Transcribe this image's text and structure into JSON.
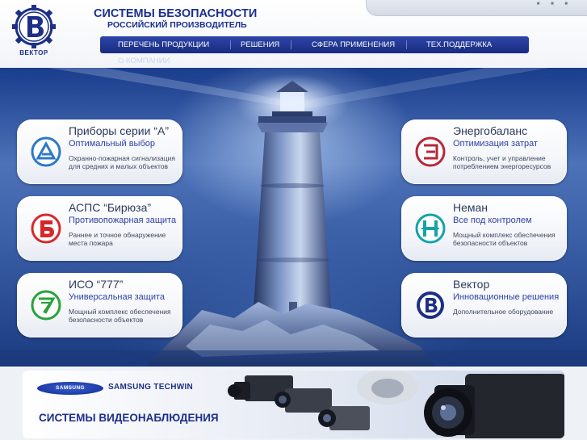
{
  "header": {
    "logo_text": "ВЕКТОР",
    "title": "СИСТЕМЫ БЕЗОПАСНОСТИ",
    "subtitle": "РОССИЙСКИЙ ПРОИЗВОДИТЕЛЬ"
  },
  "nav": {
    "items": [
      {
        "label": "ПЕРЕЧЕНЬ ПРОДУКЦИИ"
      },
      {
        "label": "РЕШЕНИЯ"
      },
      {
        "label": "СФЕРА ПРИМЕНЕНИЯ"
      },
      {
        "label": "ТЕХ.ПОДДЕРЖКА"
      },
      {
        "label": "О КОМПАНИИ"
      }
    ]
  },
  "cards": [
    {
      "title": "Приборы серии “А”",
      "subtitle": "Оптимальный выбор",
      "description": "Охранно-пожарная сигнализация для средних и малых объектов",
      "icon": "a-series-icon",
      "color": "#2d78c8"
    },
    {
      "title": "АСПС “Бирюза”",
      "subtitle": "Противопожарная защита",
      "description": "Раннее и точное обнаружение места пожара",
      "icon": "biryuza-icon",
      "color": "#d6282a"
    },
    {
      "title": "ИСО “777”",
      "subtitle": "Универсальная защита",
      "description": "Мощный комплекс обеспечения безопасности объектов",
      "icon": "iso777-icon",
      "color": "#27a33a"
    },
    {
      "title": "Энергобаланс",
      "subtitle": "Оптимизация затрат",
      "description": "Контроль, учет и управление потреблением энергоресурсов",
      "icon": "energobalans-icon",
      "color": "#b5283a"
    },
    {
      "title": "Неман",
      "subtitle": "Все под контролем",
      "description": "Мощный комплекс обеспечения безопасности объектов",
      "icon": "neman-icon",
      "color": "#14a3a8"
    },
    {
      "title": "Вектор",
      "subtitle": "Инновационные решения",
      "description": "Дополнительное оборудование",
      "icon": "vektor-icon",
      "color": "#1d2f86"
    }
  ],
  "banner": {
    "samsung_logo": "SAMSUNG",
    "techwin_text": "SAMSUNG TECHWIN",
    "caption": "СИСТЕМЫ ВИДЕОНАБЛЮДЕНИЯ"
  },
  "colors": {
    "brand": "#1b2f8f",
    "nav": "#1f3390"
  }
}
